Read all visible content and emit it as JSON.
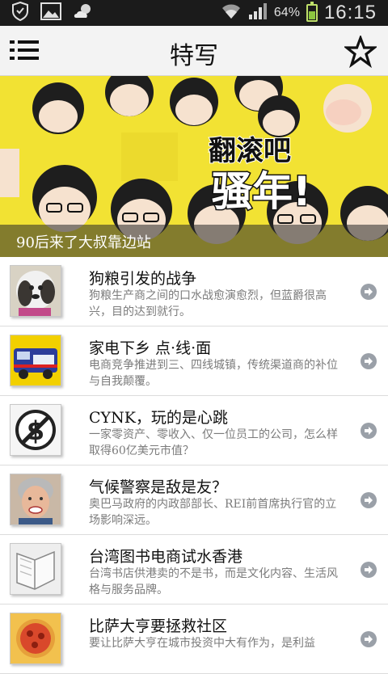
{
  "status_bar": {
    "battery_percent": "64%",
    "time": "16:15",
    "icons": [
      "shield-icon",
      "image-icon",
      "weather-icon",
      "wifi-icon",
      "signal-icon",
      "battery-icon"
    ]
  },
  "header": {
    "title": "特写",
    "menu_icon": "menu-icon",
    "star_icon": "star-icon"
  },
  "hero": {
    "caption": "90后来了大叔靠边站",
    "overlay_text_line1": "翻滚吧",
    "overlay_text_line2": "骚年!"
  },
  "articles": [
    {
      "title": "狗粮引发的战争",
      "desc": "狗粮生产商之间的口水战愈演愈烈，但蓝爵很高兴，目的达到就行。",
      "thumb": "dog"
    },
    {
      "title": "家电下乡 点·线·面",
      "desc": "电商竞争推进到三、四线城镇，传统渠道商的补位与自我颠覆。",
      "thumb": "van"
    },
    {
      "title": "CYNK，玩的是心跳",
      "desc": "一家零资产、零收入、仅一位员工的公司，怎么样取得60亿美元市值？",
      "thumb": "dollar"
    },
    {
      "title": "气候警察是敌是友？",
      "desc": "奥巴马政府的内政部部长、REI前首席执行官的立场影响深远。",
      "thumb": "woman"
    },
    {
      "title": "台湾图书电商试水香港",
      "desc": "台湾书店供港卖的不是书，而是文化内容、生活风格与服务品牌。",
      "thumb": "book"
    },
    {
      "title": "比萨大亨要拯救社区",
      "desc": "要让比萨大亨在城市投资中大有作为，是利益",
      "thumb": "pizza"
    }
  ],
  "colors": {
    "status_bg": "#1b1b1b",
    "header_bg": "#f3f3f3",
    "hero_yellow": "#f2e233",
    "arrow": "#9aa0a8"
  }
}
